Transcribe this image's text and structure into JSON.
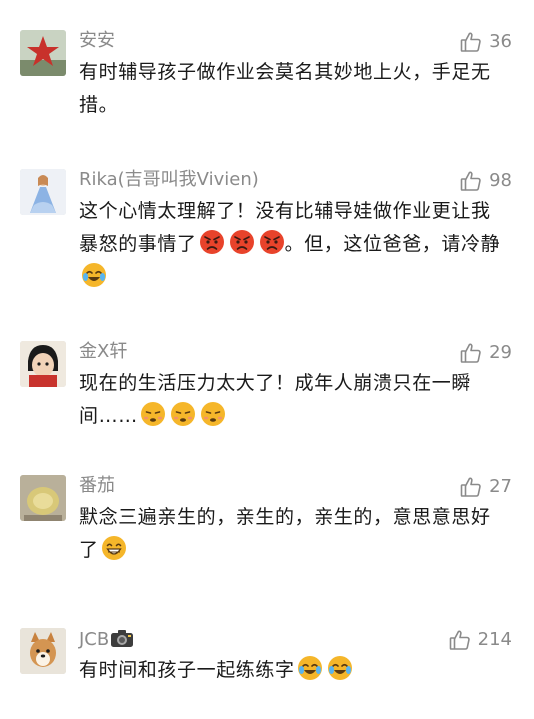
{
  "comments": [
    {
      "username": "安安",
      "likes": "36",
      "text": "有时辅导孩子做作业会莫名其妙地上火，手足无措。",
      "emoji": []
    },
    {
      "username": "Rika(吉哥叫我Vivien)",
      "likes": "98",
      "text_before": "这个心情太理解了！没有比辅导娃做作业更让我暴怒的事情了",
      "text_after": "。但，这位爸爸，请冷静",
      "emoji_mid": [
        "angry-emoji",
        "angry-emoji",
        "angry-emoji"
      ],
      "emoji_end": [
        "laugh-cry-emoji"
      ]
    },
    {
      "username": "金X轩",
      "likes": "29",
      "text": "现在的生活压力太大了！成年人崩溃只在一瞬间……",
      "emoji": [
        "pout-emoji",
        "pout-emoji",
        "pout-emoji"
      ]
    },
    {
      "username": "番茄",
      "likes": "27",
      "text": "默念三遍亲生的，亲生的，亲生的，意思意思好了",
      "emoji": [
        "grin-emoji"
      ]
    },
    {
      "username": "JCB",
      "username_badge": "camera-icon",
      "likes": "214",
      "text": "有时间和孩子一起练练字",
      "emoji": [
        "laugh-cry-emoji",
        "laugh-cry-emoji"
      ]
    }
  ],
  "colors": {
    "meta_gray": "#8a8a8a",
    "text": "#1a1a1a",
    "emoji_yellow": "#f5b62a",
    "angry_red": "#e8432b"
  }
}
